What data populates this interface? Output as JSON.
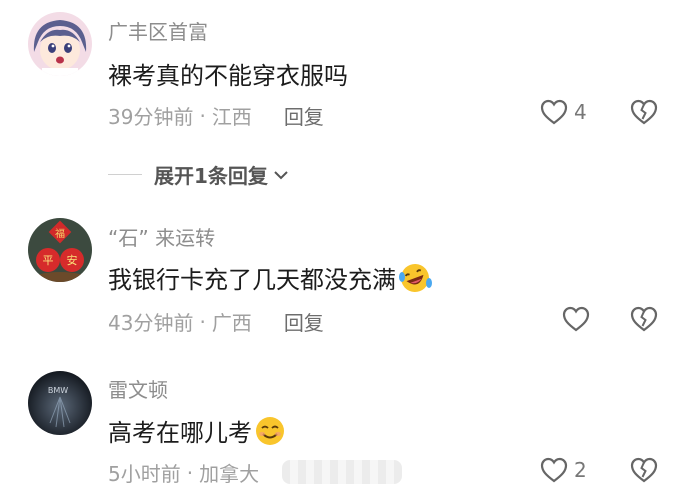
{
  "comments": [
    {
      "username": "广丰区首富",
      "text": "裸考真的不能穿衣服吗",
      "time": "39分钟前",
      "location": "江西",
      "reply_label": "回复",
      "likes": "4",
      "avatar": "anime-girl-avatar"
    },
    {
      "username": "“石” 来运转",
      "text": "我银行卡充了几天都没充满",
      "time": "43分钟前",
      "location": "广西",
      "reply_label": "回复",
      "likes": "",
      "avatar": "ping-an-apples-avatar",
      "emoji": "laughing-crying-emoji"
    },
    {
      "username": "雷文顿",
      "text": "高考在哪儿考",
      "time": "5小时前",
      "location": "加拿大",
      "reply_label": "",
      "likes": "2",
      "avatar": "bmw-avatar",
      "emoji": "smiling-emoji"
    }
  ],
  "expand": {
    "label": "展开1条回复"
  },
  "meta_separator": "·",
  "avatar_badge": {
    "fu": "福",
    "ping": "平",
    "an": "安",
    "bmw": "BMW"
  }
}
